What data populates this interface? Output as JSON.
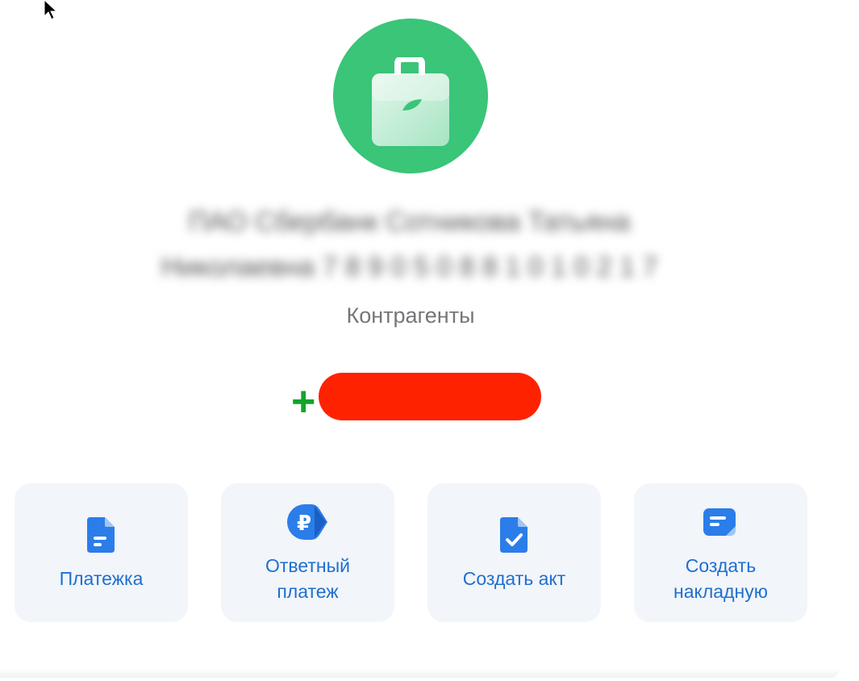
{
  "counterparty": {
    "name_line1": "ПАО Сбербанк Сотникова Татьяна",
    "name_line2": "Николаевна 7 8 9 0 5 0 8 8 1 0 1 0 2 1 7",
    "category": "Контрагенты",
    "phone_redacted": "",
    "add_symbol": "+"
  },
  "actions": [
    {
      "line1": "Платежка",
      "line2": ""
    },
    {
      "line1": "Ответный",
      "line2": "платеж"
    },
    {
      "line1": "Создать акт",
      "line2": ""
    },
    {
      "line1": "Создать",
      "line2": "накладную"
    }
  ],
  "colors": {
    "avatar_green": "#3ac579",
    "accent_blue": "#1f6fd1",
    "redaction_red": "#ff2200",
    "plus_green": "#15a32a"
  },
  "icons": {
    "avatar": "briefcase-icon",
    "action_1": "document-icon",
    "action_2": "ruble-arrow-icon",
    "action_3": "document-check-icon",
    "action_4": "invoice-icon"
  }
}
